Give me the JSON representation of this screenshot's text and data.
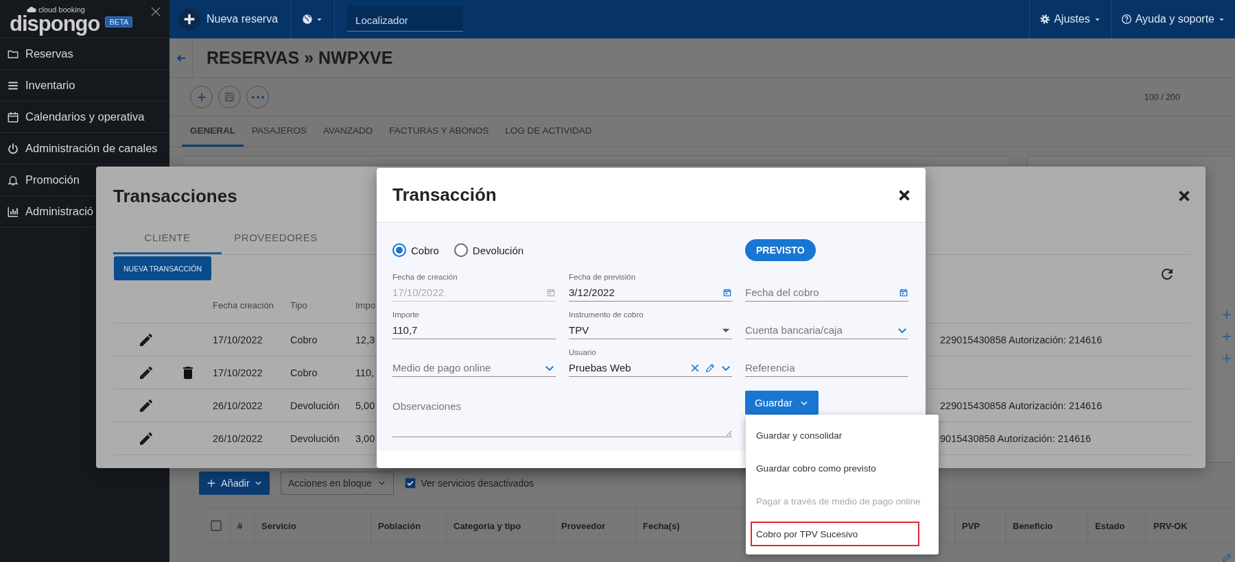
{
  "sidebar": {
    "logo_tagline": "cloud booking",
    "logo_name": "dispongo",
    "badge": "BETA",
    "items": [
      "Reservas",
      "Inventario",
      "Calendarios y operativa",
      "Administración de canales",
      "Promoción",
      "Administració"
    ]
  },
  "header": {
    "new_booking_button": "Nueva reserva",
    "search": {
      "placeholder": "Localizador"
    },
    "menus": [
      "Ajustes",
      "Ayuda y soporte"
    ]
  },
  "page": {
    "title": "RESERVAS » NWPXVE",
    "counter": "100 / 200",
    "tabs": [
      {
        "label": "GENERAL",
        "selected": true
      },
      {
        "label": "PASAJEROS",
        "selected": false
      },
      {
        "label": "AVANZADO",
        "selected": false
      },
      {
        "label": "FACTURAS Y ABONOS",
        "selected": false
      },
      {
        "label": "LOG DE ACTIVIDAD",
        "selected": false
      }
    ],
    "add_button": "Añadir",
    "bulk_actions": "Acciones en bloque",
    "show_disabled": {
      "label": "Ver servicios desactivados",
      "checked": true
    },
    "services_table": {
      "select_all": {
        "checked": false
      },
      "columns": [
        "#",
        "Servicio",
        "Población",
        "Categoría y tipo",
        "Proveedor",
        "Fecha(s)",
        "PVP",
        "Beneficio",
        "Estado",
        "PRV-OK"
      ]
    }
  },
  "transactions": {
    "title": "Transacciones",
    "tabs": [
      {
        "label": "CLIENTE",
        "selected": true
      },
      {
        "label": "PROVEEDORES",
        "selected": false
      }
    ],
    "new_button": "NUEVA TRANSACCIÓN",
    "columns": [
      "Fecha creación",
      "Tipo",
      "Impo"
    ],
    "rows": [
      {
        "date": "17/10/2022",
        "type": "Cobro",
        "amount": "12,3",
        "deletable": false,
        "details": "229015430858 Autorización: 214616"
      },
      {
        "date": "17/10/2022",
        "type": "Cobro",
        "amount": "110,",
        "deletable": true
      },
      {
        "date": "26/10/2022",
        "type": "Devolución",
        "amount": "5,00",
        "deletable": false,
        "details": "229015430858 Autorización: 214616"
      },
      {
        "date": "26/10/2022",
        "type": "Devolución",
        "amount": "3,00",
        "deletable": false,
        "details": "9015430858 Autorización: 214616"
      }
    ]
  },
  "transaction": {
    "title": "Transacción",
    "type_options": [
      {
        "label": "Cobro",
        "selected": true
      },
      {
        "label": "Devolución",
        "selected": false
      }
    ],
    "status": "PREVISTO",
    "fields": [
      {
        "kind": "date",
        "label": "Fecha de creación",
        "value": "17/10/2022",
        "disabled": true
      },
      {
        "kind": "date",
        "label": "Fecha de previsión",
        "value": "3/12/2022",
        "disabled": false
      },
      {
        "kind": "date",
        "placeholder": "Fecha del cobro",
        "disabled": false
      },
      {
        "kind": "text",
        "label": "Importe",
        "value": "110,7",
        "disabled": false
      },
      {
        "kind": "select",
        "label": "Instrumento de cobro",
        "value": "TPV",
        "disabled": false
      },
      {
        "kind": "combo",
        "placeholder": "Cuenta bancaria/caja",
        "disabled": false
      },
      {
        "kind": "combo",
        "placeholder": "Medio de pago online",
        "disabled": false
      },
      {
        "kind": "user",
        "label": "Usuario",
        "value": "Pruebas Web",
        "disabled": false
      },
      {
        "kind": "text",
        "placeholder": "Referencia",
        "disabled": false
      }
    ],
    "observations": {
      "placeholder": "Observaciones"
    },
    "save_button": "Guardar",
    "save_menu": [
      {
        "label": "Guardar y consolidar",
        "disabled": false,
        "highlighted": false
      },
      {
        "label": "Guardar cobro como previsto",
        "disabled": false,
        "highlighted": false
      },
      {
        "label": "Pagar a través de medio de pago online",
        "disabled": true,
        "highlighted": false
      },
      {
        "label": "Cobro por TPV Sucesivo",
        "disabled": false,
        "highlighted": true
      }
    ]
  }
}
